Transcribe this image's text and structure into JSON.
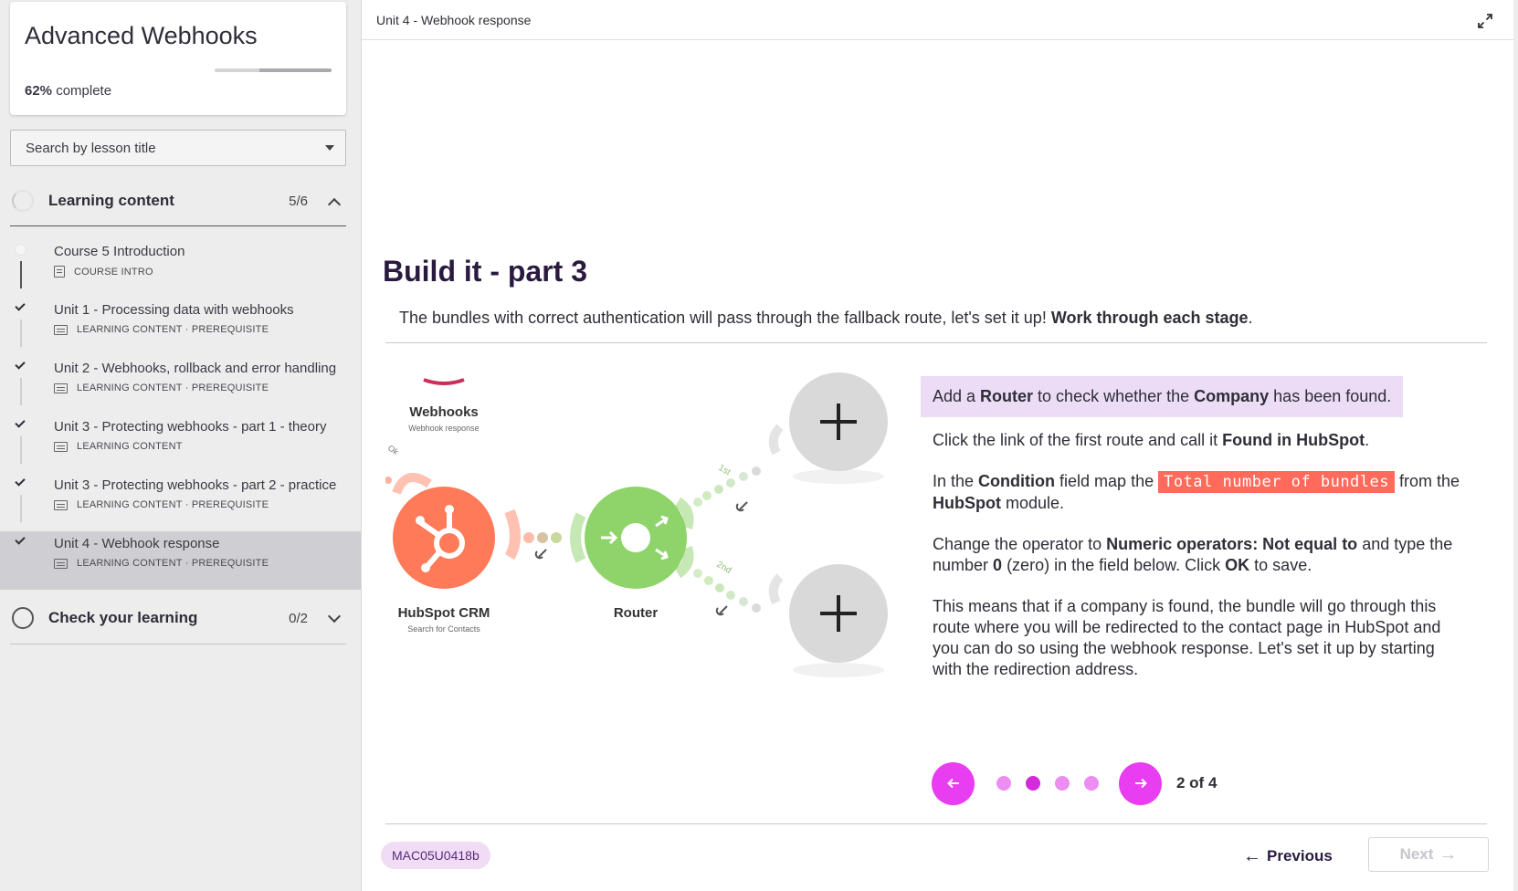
{
  "sidebar": {
    "course_title": "Advanced Webhooks",
    "progress_percent": "62%",
    "progress_suffix": "complete",
    "progress_value": 0.62,
    "search_placeholder": "Search by lesson title",
    "sections": [
      {
        "label": "Learning content",
        "count": "5/6"
      },
      {
        "label": "Check your learning",
        "count": "0/2"
      }
    ],
    "lessons": [
      {
        "title": "Course 5 Introduction",
        "meta": "COURSE INTRO",
        "done": false
      },
      {
        "title": "Unit 1 - Processing data with webhooks",
        "meta": "LEARNING CONTENT · PREREQUISITE",
        "done": true
      },
      {
        "title": "Unit 2 - Webhooks, rollback and error handling",
        "meta": "LEARNING CONTENT · PREREQUISITE",
        "done": true
      },
      {
        "title": "Unit 3 - Protecting webhooks - part 1 - theory",
        "meta": "LEARNING CONTENT",
        "done": true
      },
      {
        "title": "Unit 3 - Protecting webhooks - part 2 - practice",
        "meta": "LEARNING CONTENT · PREREQUISITE",
        "done": true
      },
      {
        "title": "Unit 4 - Webhook response",
        "meta": "LEARNING CONTENT · PREREQUISITE",
        "done": true,
        "active": true
      }
    ]
  },
  "main": {
    "unit_title": "Unit 4 - Webhook response",
    "page_title": "Build it - part 3",
    "intro_text": "The bundles with correct authentication will pass through the fallback route, let's set it up! ",
    "intro_bold": "Work through each stage",
    "intro_end": ".",
    "diagram": {
      "webhooks_label": "Webhooks",
      "webhooks_sub": "Webhook response",
      "hubspot_label": "HubSpot CRM",
      "hubspot_sub": "Search for Contacts",
      "router_label": "Router",
      "route1": "1st",
      "route2": "2nd",
      "ok_label": "Ok"
    },
    "steps": {
      "s1": {
        "a": "Add a ",
        "b1": "Router",
        "c": " to check whether the ",
        "b2": "Company",
        "d": " has been found."
      },
      "s2": {
        "a": "Click the link of the first route and call it ",
        "b1": "Found in HubSpot",
        "c": "."
      },
      "s3": {
        "a": "In the ",
        "b1": "Condition",
        "c": " field map the ",
        "code": "Total number of bundles",
        "d": " from the ",
        "b2": "HubSpot",
        "e": " module."
      },
      "s4": {
        "a": "Change the operator to ",
        "b1": "Numeric operators: Not equal to",
        "c": " and type the number ",
        "b2": "0",
        "d": " (zero) in the field below. Click ",
        "b3": "OK",
        "e": " to save."
      },
      "s5": "This means that if a company is found, the bundle will go through this route where you will be redirected to the contact page in HubSpot and you can do so using the webhook response. Let's set it up by starting with the redirection address."
    },
    "pager": {
      "label": "2 of 4",
      "current": 2,
      "total": 4
    },
    "lesson_code": "MAC05U0418b",
    "previous_label": "Previous",
    "next_label": "Next",
    "colors": {
      "accent": "#e83df0",
      "accent_light": "#eb8df1",
      "hubspot": "#ff7a59",
      "router": "#8fd46a",
      "highlight": "#ecdcf5",
      "code_chip": "#ff6a5a"
    }
  }
}
